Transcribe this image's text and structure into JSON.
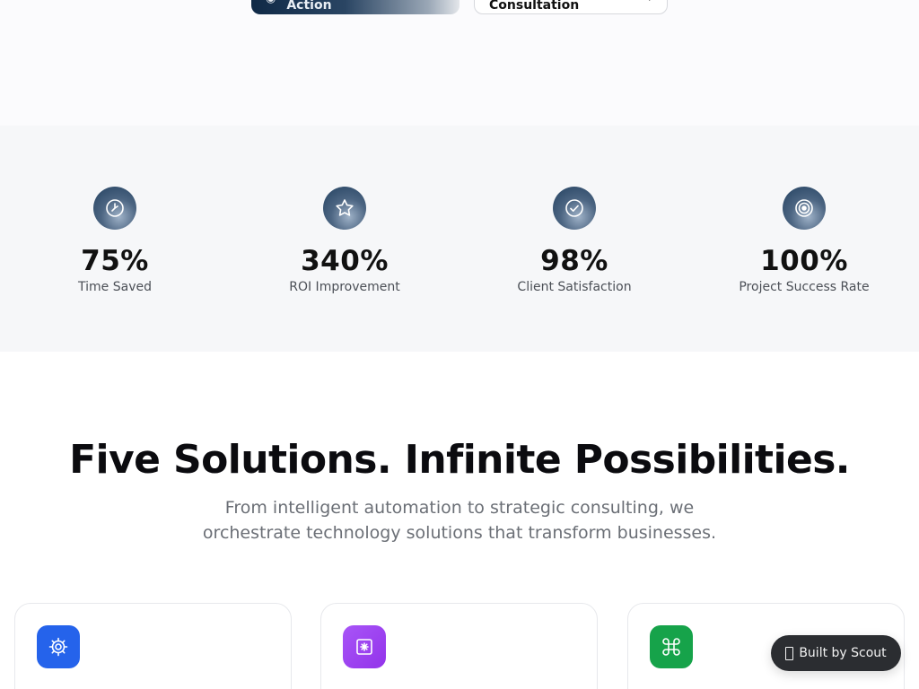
{
  "hero": {
    "primary_button_label": "See Automation In Action",
    "secondary_button_label": "Schedule Consultation",
    "secondary_button_icon": "arrow-right-icon"
  },
  "stats": [
    {
      "icon": "clock-icon",
      "value": "75%",
      "label": "Time Saved"
    },
    {
      "icon": "star-icon",
      "value": "340%",
      "label": "ROI Improvement"
    },
    {
      "icon": "check-circle-icon",
      "value": "98%",
      "label": "Client Satisfaction"
    },
    {
      "icon": "target-icon",
      "value": "100%",
      "label": "Project Success Rate"
    }
  ],
  "solutions": {
    "title": "Five Solutions. Infinite Possibilities.",
    "subtitle": "From intelligent automation to strategic consulting, we orchestrate technology solutions that transform businesses.",
    "cards": [
      {
        "icon": "gear-icon",
        "color": "#2563eb"
      },
      {
        "icon": "sparkle-box-icon",
        "color": "#9333ea"
      },
      {
        "icon": "command-icon",
        "color": "#16a34a"
      }
    ]
  },
  "badge": {
    "label": "Built by Scout"
  },
  "colors": {
    "stat_icon_bg": "#2a4563",
    "stats_band_bg": "#f6f7f9",
    "title_color": "#0b0b0f"
  }
}
